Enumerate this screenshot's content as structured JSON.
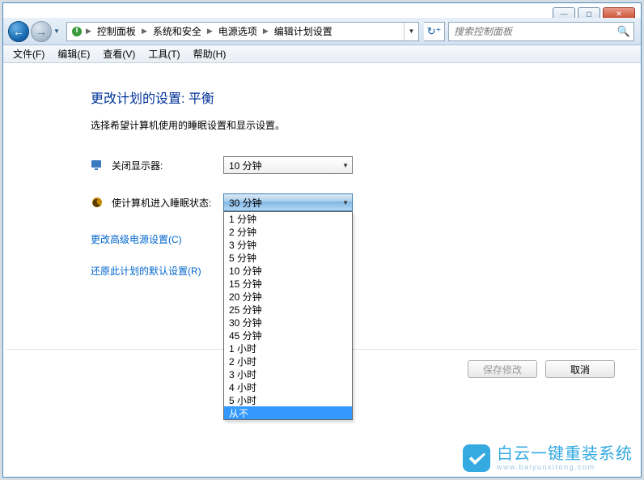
{
  "window": {
    "minimize_glyph": "—",
    "maximize_glyph": "◻",
    "close_glyph": "✕"
  },
  "nav": {
    "back_glyph": "←",
    "fwd_glyph": "→",
    "nav_caret": "▼",
    "breadcrumbs": [
      "控制面板",
      "系统和安全",
      "电源选项",
      "编辑计划设置"
    ],
    "crumb_sep": "▶",
    "addrbar_caret": "▼",
    "refresh_glyph": "↻"
  },
  "search": {
    "placeholder": "搜索控制面板"
  },
  "menu": {
    "file": "文件(F)",
    "edit": "编辑(E)",
    "view": "查看(V)",
    "tools": "工具(T)",
    "help": "帮助(H)"
  },
  "page": {
    "title": "更改计划的设置: 平衡",
    "desc": "选择希望计算机使用的睡眠设置和显示设置。",
    "display_off_label": "关闭显示器:",
    "sleep_label": "使计算机进入睡眠状态:",
    "display_off_value": "10 分钟",
    "sleep_value": "30 分钟",
    "sleep_options": [
      "1 分钟",
      "2 分钟",
      "3 分钟",
      "5 分钟",
      "10 分钟",
      "15 分钟",
      "20 分钟",
      "25 分钟",
      "30 分钟",
      "45 分钟",
      "1 小时",
      "2 小时",
      "3 小时",
      "4 小时",
      "5 小时",
      "从不"
    ],
    "sleep_selected_index": 15,
    "caret": "▼",
    "adv_link": "更改高级电源设置(C)",
    "restore_link": "还原此计划的默认设置(R)",
    "save_btn": "保存修改",
    "cancel_btn": "取消"
  },
  "watermark": {
    "text": "白云一键重装系统",
    "url": "www.baiyunxitong.com"
  }
}
